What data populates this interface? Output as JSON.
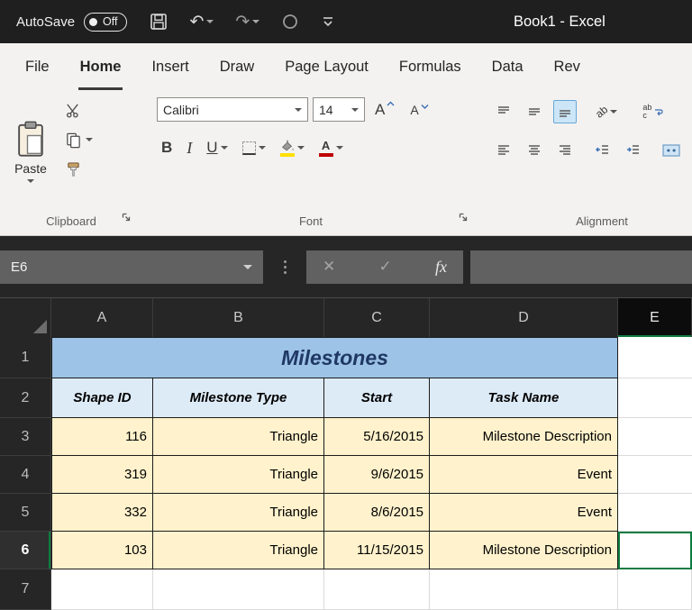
{
  "titlebar": {
    "autosave_label": "AutoSave",
    "autosave_state": "Off",
    "document_title": "Book1  -  Excel"
  },
  "tabs": [
    "File",
    "Home",
    "Insert",
    "Draw",
    "Page Layout",
    "Formulas",
    "Data",
    "Rev"
  ],
  "ribbon": {
    "clipboard": {
      "group_label": "Clipboard",
      "paste_label": "Paste"
    },
    "font": {
      "group_label": "Font",
      "font_name": "Calibri",
      "font_size": "14",
      "bold": "B",
      "italic": "I",
      "underline": "U",
      "grow_letter": "A",
      "shrink_letter": "A",
      "font_color_letter": "A"
    },
    "alignment": {
      "group_label": "Alignment",
      "orientation_text": "ab",
      "wrap_line1": "ab",
      "wrap_line2": "c"
    }
  },
  "formula_bar": {
    "name_box": "E6",
    "fx_label": "fx"
  },
  "sheet": {
    "selected_cell": "E6",
    "column_headers": [
      "A",
      "B",
      "C",
      "D",
      "E"
    ],
    "row_headers": [
      "1",
      "2",
      "3",
      "4",
      "5",
      "6",
      "7"
    ],
    "title_banner": "Milestones",
    "table_headers": [
      "Shape ID",
      "Milestone Type",
      "Start",
      "Task Name"
    ],
    "table_rows": [
      [
        "116",
        "Triangle",
        "5/16/2015",
        "Milestone Description"
      ],
      [
        "319",
        "Triangle",
        "9/6/2015",
        "Event"
      ],
      [
        "332",
        "Triangle",
        "8/6/2015",
        "Event"
      ],
      [
        "103",
        "Triangle",
        "11/15/2015",
        "Milestone Description"
      ]
    ]
  },
  "colors": {
    "banner_fill": "#9DC3E6",
    "banner_text": "#1F3864",
    "header_fill": "#DDEBF7",
    "data_fill": "#FFF2CC",
    "selection_green": "#107C41",
    "fill_swatch": "#FFE000",
    "font_color_swatch": "#C00000"
  }
}
